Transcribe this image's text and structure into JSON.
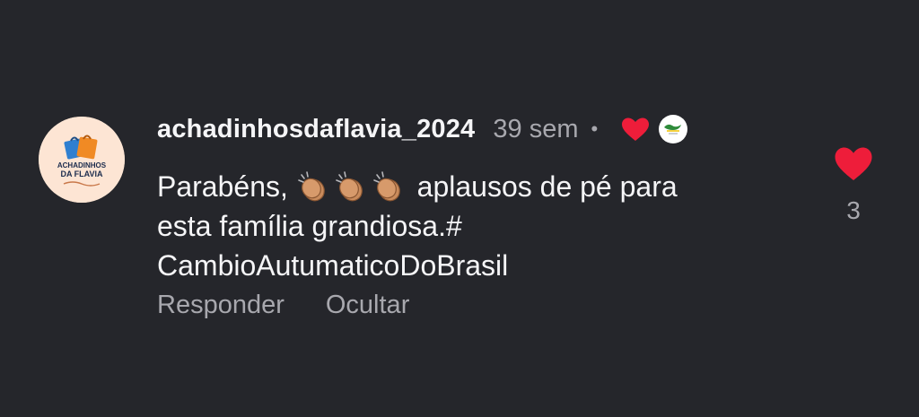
{
  "comment": {
    "username": "achadinhosdaflavia_2024",
    "time": "39 sem",
    "separator": "•",
    "text_part1": "Parabéns,",
    "text_part2": "aplausos de pé para",
    "text_line2": "esta família grandiosa.#",
    "text_line3": "CambioAutumaticoDoBrasil",
    "emojis": [
      "clapping-hands",
      "clapping-hands",
      "clapping-hands"
    ],
    "liked_by_creator": true
  },
  "avatar": {
    "brand_line1": "ACHADINHOS",
    "brand_line2": "DA FLAVIA"
  },
  "actions": {
    "reply_label": "Responder",
    "hide_label": "Ocultar"
  },
  "like": {
    "count": "3",
    "liked": true
  },
  "colors": {
    "background": "#25262b",
    "heart": "#ee1d3a",
    "secondary_text": "#a8a8ae",
    "avatar_bg": "#fde5d4"
  }
}
